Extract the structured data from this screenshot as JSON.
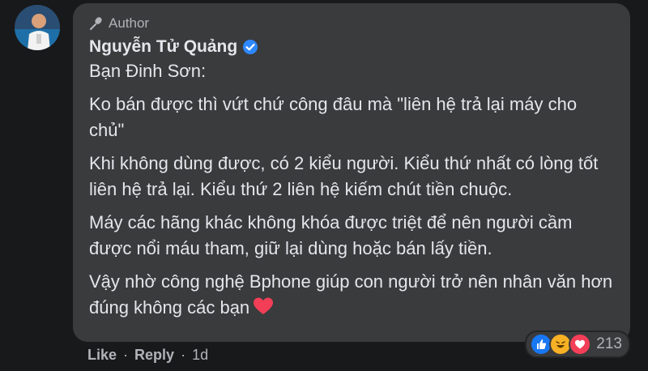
{
  "comment": {
    "author_badge": "Author",
    "author_name": "Nguyễn Tử Quảng",
    "paragraphs": [
      "Bạn Đinh Sơn:",
      "Ko bán được thì vứt chứ công đâu mà \"liên hệ trả lại máy cho chủ\"",
      "Khi không dùng được, có 2 kiểu người. Kiểu thứ nhất có lòng tốt liên hệ trả lại. Kiểu thứ 2 liên hệ kiếm chút tiền chuộc.",
      "Máy các hãng khác không khóa được triệt để nên người cầm được nổi máu tham, giữ lại dùng hoặc bán lấy tiền.",
      "Vậy nhờ công nghệ Bphone giúp con người trở nên nhân văn hơn đúng không các bạn"
    ],
    "reaction_count": "213",
    "reaction_icons": [
      "like-icon",
      "haha-icon",
      "love-icon"
    ]
  },
  "actions": {
    "like_label": "Like",
    "separator": "·",
    "reply_label": "Reply",
    "time": "1d"
  },
  "colors": {
    "background": "#18191a",
    "bubble": "#3a3b3c",
    "text": "#e4e6eb",
    "muted": "#b0b3b8",
    "verified": "#2d88ff",
    "like_blue": "#1877f2",
    "love_red": "#f33e58",
    "haha_yellow": "#f7b125"
  }
}
